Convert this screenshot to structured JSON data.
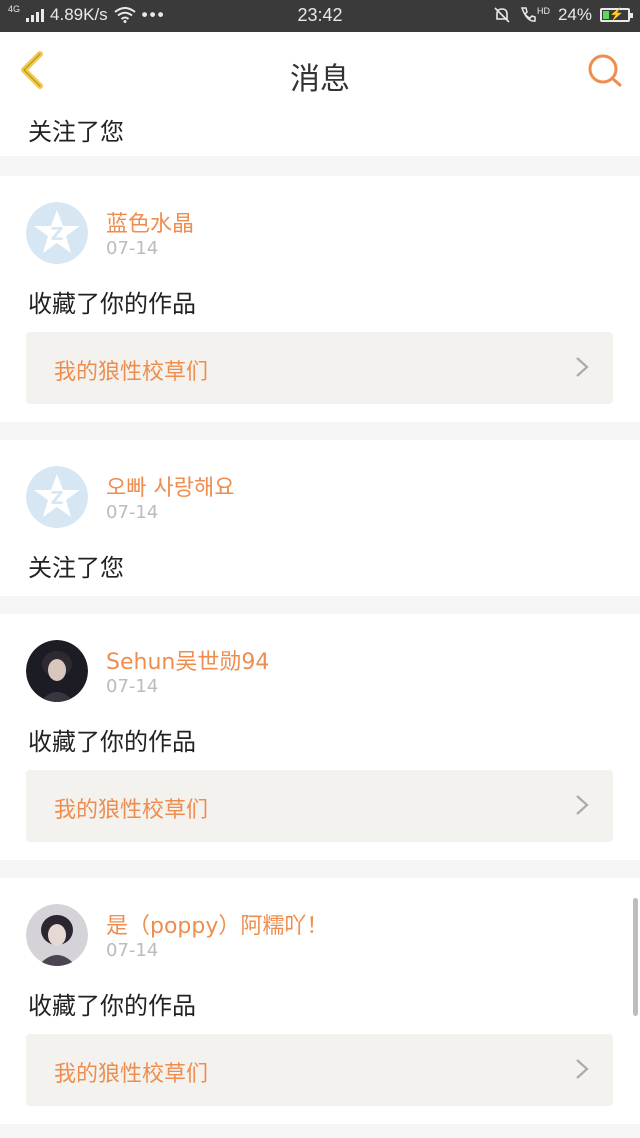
{
  "status_bar": {
    "network": "4G",
    "speed": "4.89K/s",
    "more": "•••",
    "time": "23:42",
    "hd": "HD",
    "battery": "24%"
  },
  "header": {
    "title": "消息",
    "back_icon": "chevron-left-icon",
    "search_icon": "search-icon"
  },
  "colors": {
    "accent": "#ef8d4f",
    "back_arrow": "#f3c94b",
    "card_bg": "#ffffff",
    "divider": "#f5f5f5",
    "work_bg": "#f3f2ee"
  },
  "messages": [
    {
      "action": "关注了您"
    },
    {
      "name": "蓝色水晶",
      "date": "07-14",
      "action": "收藏了你的作品",
      "work": "我的狼性校草们",
      "avatar": "default-avatar-icon"
    },
    {
      "name": "오빠 사랑해요",
      "date": "07-14",
      "action": "关注了您",
      "avatar": "default-avatar-icon"
    },
    {
      "name": "Sehun吴世勋94",
      "date": "07-14",
      "action": "收藏了你的作品",
      "work": "我的狼性校草们",
      "avatar": "user-photo"
    },
    {
      "name": "是（poppy）阿糯吖！",
      "date": "07-14",
      "action": "收藏了你的作品",
      "work": "我的狼性校草们",
      "avatar": "user-photo"
    }
  ]
}
